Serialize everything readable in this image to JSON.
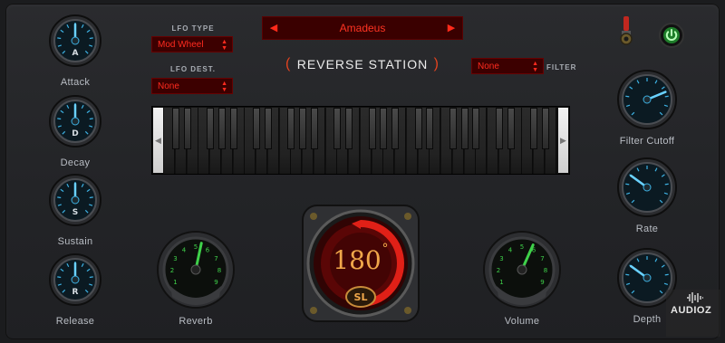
{
  "preset": {
    "name": "Amadeus",
    "prev": "◀",
    "next": "▶"
  },
  "title": "REVERSE STATION",
  "lfo": {
    "type_label": "LFO TYPE",
    "type_value": "Mod Wheel",
    "dest_label": "LFO DEST.",
    "dest_value": "None"
  },
  "filter": {
    "label": "FILTER",
    "value": "None"
  },
  "envelope": [
    {
      "letter": "A",
      "label": "Attack",
      "level": 0.5
    },
    {
      "letter": "D",
      "label": "Decay",
      "level": 0.5
    },
    {
      "letter": "S",
      "label": "Sustain",
      "level": 0.5
    },
    {
      "letter": "R",
      "label": "Release",
      "level": 0.5
    }
  ],
  "right_knobs": [
    {
      "label": "Filter Cutoff",
      "level": 0.75
    },
    {
      "label": "Rate",
      "level": 0.3
    },
    {
      "label": "Depth",
      "level": 0.3
    }
  ],
  "reverb": {
    "label": "Reverb",
    "level": 0.55
  },
  "volume": {
    "label": "Volume",
    "level": 0.6
  },
  "dial": {
    "value": "180",
    "unit": "°",
    "logo": "SL"
  },
  "colors": {
    "accent_red": "#ff2b1f",
    "knob_blue": "#3db2e4",
    "gauge_green": "#3fd14a",
    "panel": "#25262a"
  },
  "watermark": "AUDIOZ"
}
